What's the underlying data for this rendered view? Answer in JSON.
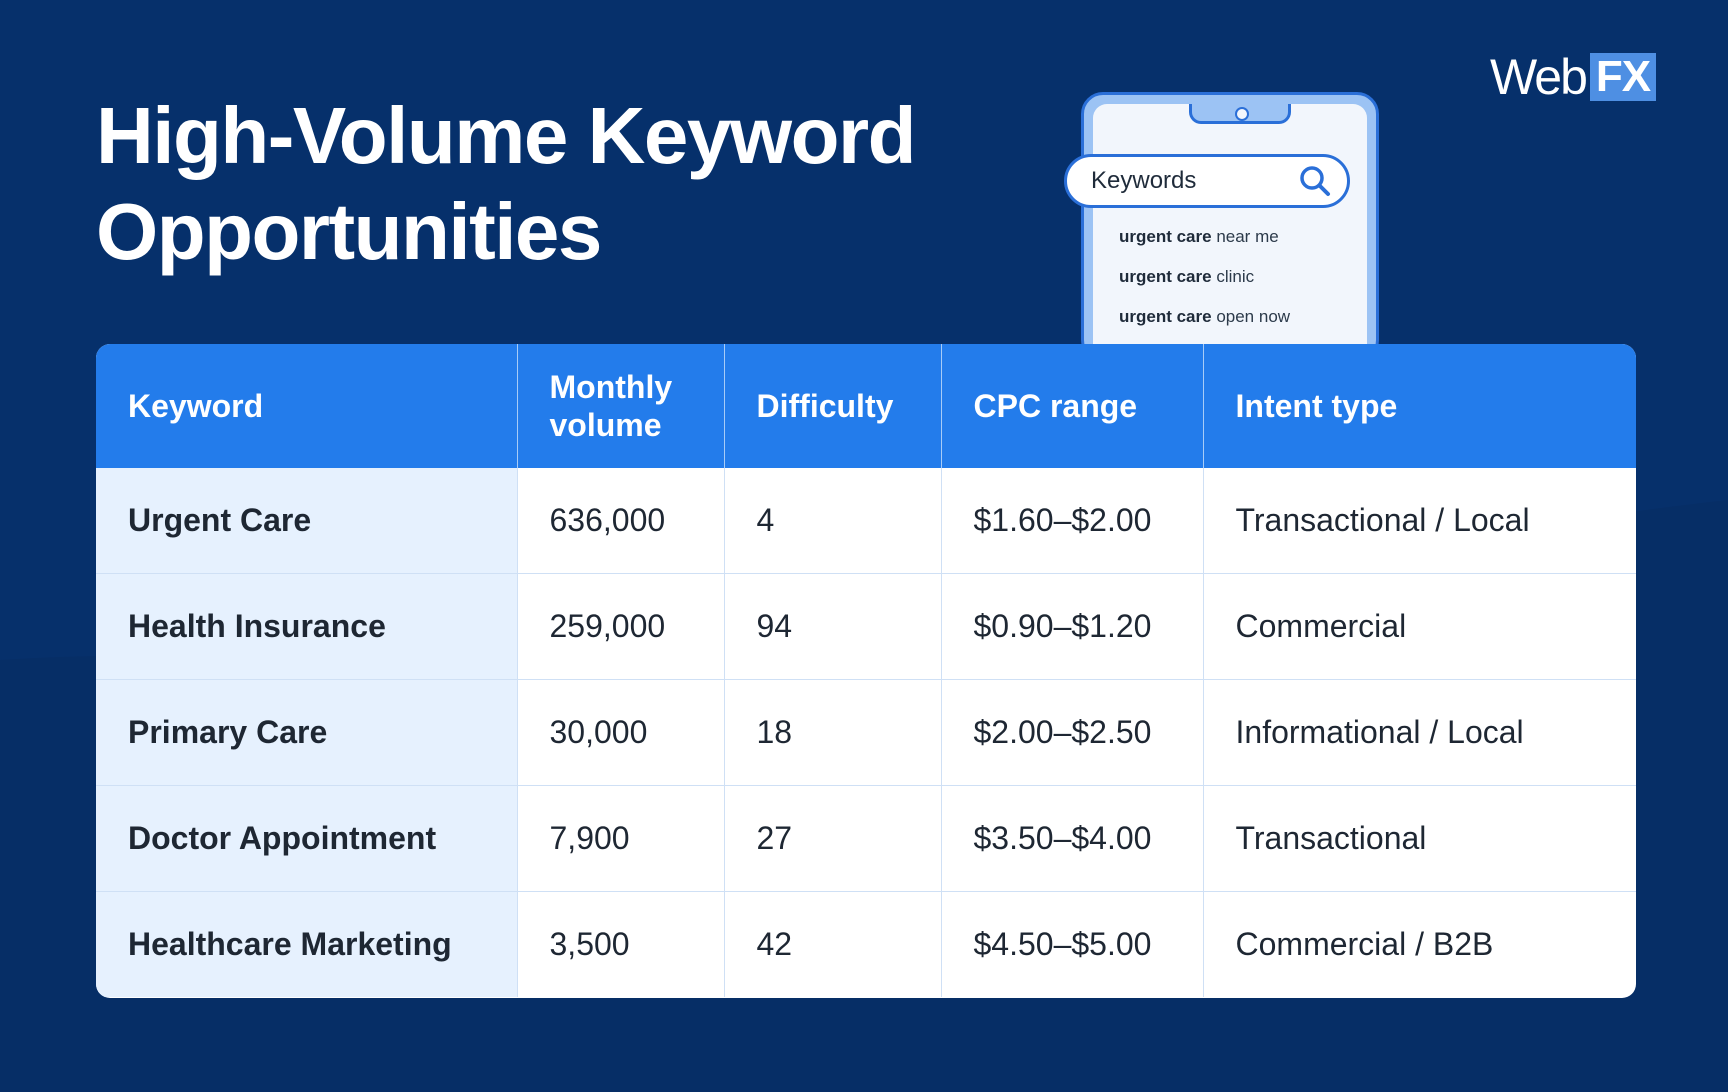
{
  "title": {
    "line1": "High-Volume Keyword",
    "line2": "Opportunities"
  },
  "logo": {
    "web": "Web",
    "fx": "FX"
  },
  "phone": {
    "search_text": "Keywords",
    "suggestions": [
      {
        "bold": "urgent care",
        "rest": " near me"
      },
      {
        "bold": "urgent care",
        "rest": " clinic"
      },
      {
        "bold": "urgent care",
        "rest": " open now"
      }
    ]
  },
  "table": {
    "headers": [
      "Keyword",
      "Monthly volume",
      "Difficulty",
      "CPC range",
      "Intent type"
    ],
    "rows": [
      [
        "Urgent Care",
        "636,000",
        "4",
        "$1.60–$2.00",
        "Transactional / Local"
      ],
      [
        "Health Insurance",
        "259,000",
        "94",
        "$0.90–$1.20",
        "Commercial"
      ],
      [
        "Primary Care",
        "30,000",
        "18",
        "$2.00–$2.50",
        "Informational / Local"
      ],
      [
        "Doctor Appointment",
        "7,900",
        "27",
        "$3.50–$4.00",
        "Transactional"
      ],
      [
        "Healthcare Marketing",
        "3,500",
        "42",
        "$4.50–$5.00",
        "Commercial / B2B"
      ]
    ]
  },
  "colors": {
    "background": "#06306b",
    "header": "#237ceb",
    "first_column": "#e6f1fe",
    "accent": "#2a6fd8"
  }
}
